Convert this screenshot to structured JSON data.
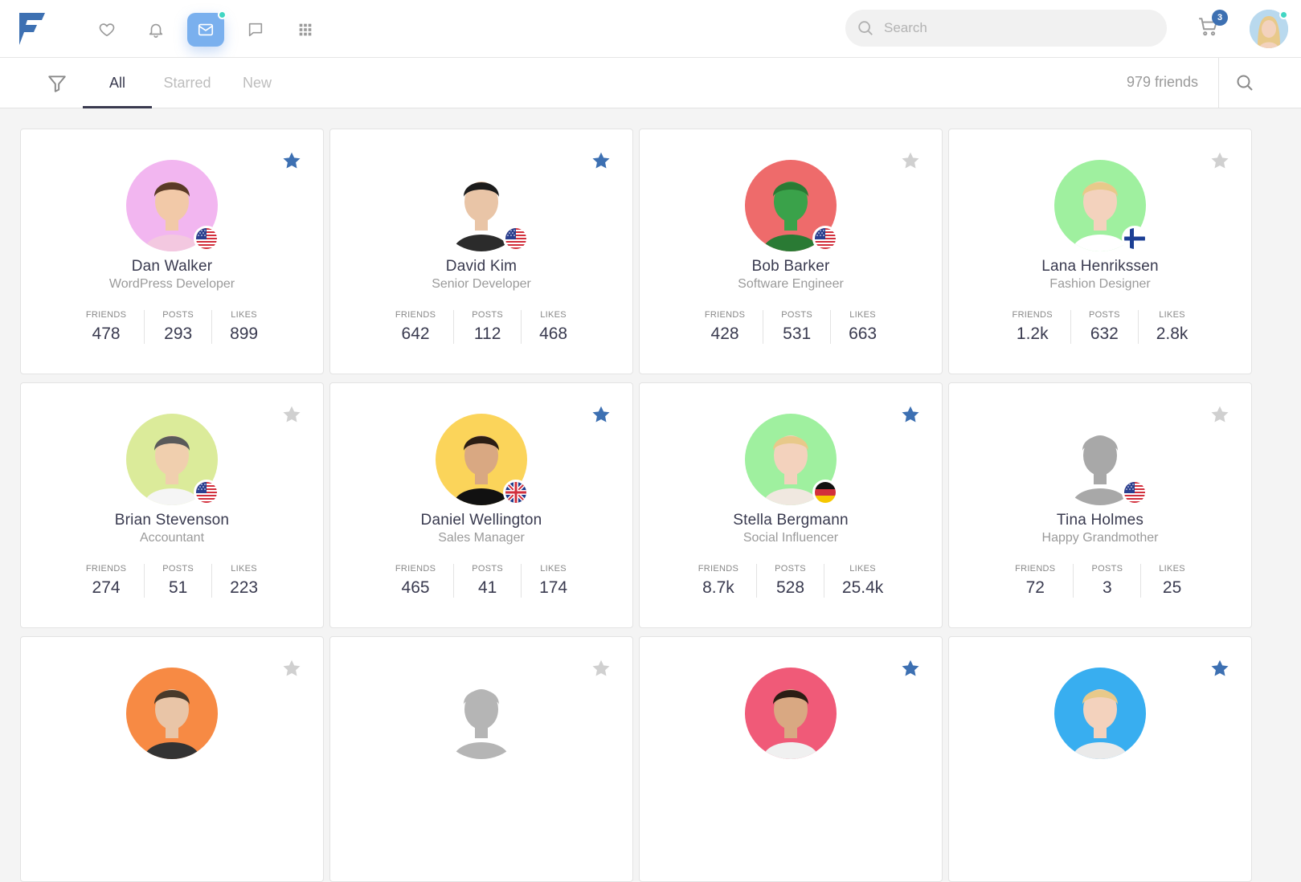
{
  "header": {
    "search_placeholder": "Search",
    "cart_count": "3"
  },
  "tabs": [
    {
      "label": "All"
    },
    {
      "label": "Starred"
    },
    {
      "label": "New"
    }
  ],
  "friends_count": "979 friends",
  "stat_labels": {
    "friends": "FRIENDS",
    "posts": "POSTS",
    "likes": "LIKES"
  },
  "colors": {
    "accent": "#3d70b2",
    "active_nav": "#7ab0ee",
    "online": "#41d6c3",
    "star_off": "#d0d0d0"
  },
  "cards": [
    {
      "name": "Dan Walker",
      "role": "WordPress Developer",
      "friends": "478",
      "posts": "293",
      "likes": "899",
      "starred": true,
      "flag": "us",
      "avatar_bg": "#f2b6f0"
    },
    {
      "name": "David Kim",
      "role": "Senior Developer",
      "friends": "642",
      "posts": "112",
      "likes": "468",
      "starred": true,
      "flag": "us",
      "avatar_bg": "#ffffff"
    },
    {
      "name": "Bob Barker",
      "role": "Software Engineer",
      "friends": "428",
      "posts": "531",
      "likes": "663",
      "starred": false,
      "flag": "us",
      "avatar_bg": "#ee6b6b"
    },
    {
      "name": "Lana Henrikssen",
      "role": "Fashion Designer",
      "friends": "1.2k",
      "posts": "632",
      "likes": "2.8k",
      "starred": false,
      "flag": "fi",
      "avatar_bg": "#9ff09f"
    },
    {
      "name": "Brian Stevenson",
      "role": "Accountant",
      "friends": "274",
      "posts": "51",
      "likes": "223",
      "starred": false,
      "flag": "us",
      "avatar_bg": "#dbeb9a"
    },
    {
      "name": "Daniel Wellington",
      "role": "Sales Manager",
      "friends": "465",
      "posts": "41",
      "likes": "174",
      "starred": true,
      "flag": "gb",
      "avatar_bg": "#fbd45a"
    },
    {
      "name": "Stella Bergmann",
      "role": "Social Influencer",
      "friends": "8.7k",
      "posts": "528",
      "likes": "25.4k",
      "starred": true,
      "flag": "de",
      "avatar_bg": "#9ff09f"
    },
    {
      "name": "Tina Holmes",
      "role": "Happy Grandmother",
      "friends": "72",
      "posts": "3",
      "likes": "25",
      "starred": false,
      "flag": "us",
      "avatar_bg": "#ffffff"
    },
    {
      "starred": false,
      "avatar_bg": "#f78a44"
    },
    {
      "starred": false,
      "avatar_bg": "#ffffff"
    },
    {
      "starred": true,
      "avatar_bg": "#f05a78"
    },
    {
      "starred": true,
      "avatar_bg": "#38aef0"
    }
  ]
}
